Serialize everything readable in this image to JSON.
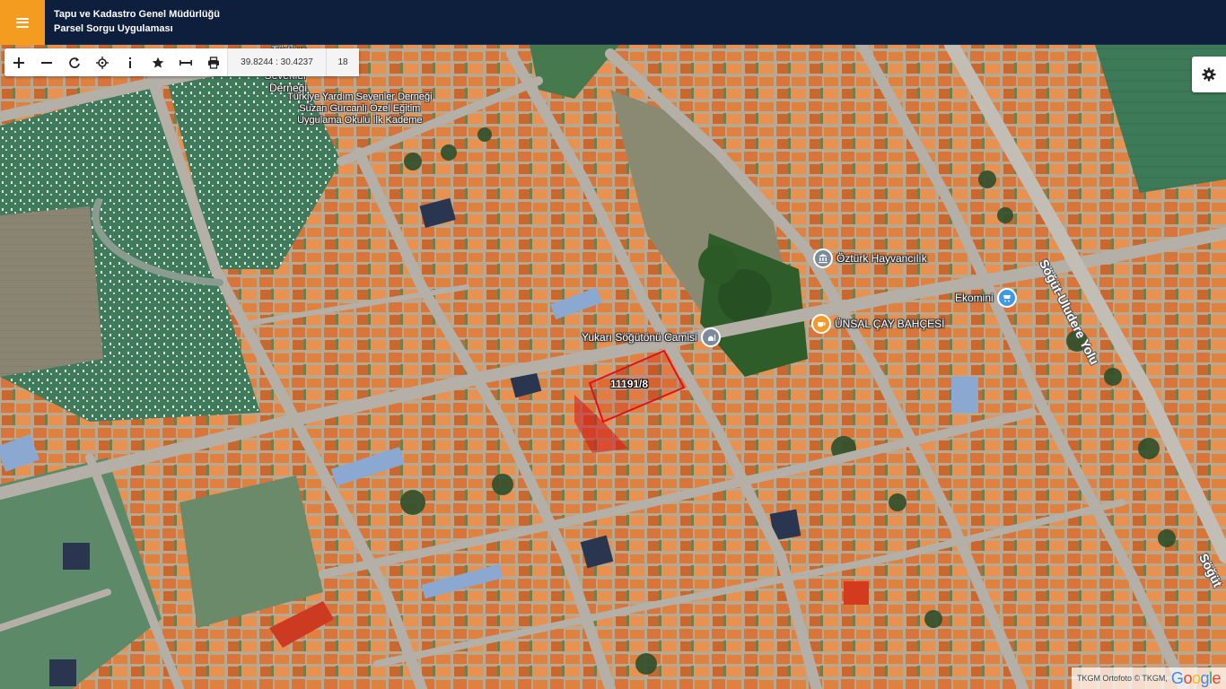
{
  "header": {
    "line1": "Tapu ve Kadastro Genel Müdürlüğü",
    "line2": "Parsel Sorgu Uygulaması"
  },
  "toolbar": {
    "tools": [
      {
        "icon": "plus-icon"
      },
      {
        "icon": "minus-icon"
      },
      {
        "icon": "refresh-icon"
      },
      {
        "icon": "crosshair-icon"
      },
      {
        "icon": "info-icon"
      },
      {
        "icon": "star-icon"
      },
      {
        "icon": "measure-icon"
      },
      {
        "icon": "print-icon"
      }
    ],
    "coordinates": "39.8244 : 30.4237",
    "zoom": "18"
  },
  "map": {
    "parcel_label": "11191/8",
    "pois": {
      "dernegi_title": "Türkiye Yardım\nSevenler Derneği",
      "okul": "Türkiye Yardım Sevenler Derneği\nSuzan Gürcanlı Özel Eğitim\nUygulama Okulu İlk Kademe",
      "hayvancilik": "Öztürk Hayvancılık",
      "ekomini": "Ekomini",
      "cay_bahcesi": "ÜNSAL ÇAY BAHÇESİ",
      "camii": "Yukarı Söğütönü Camisi"
    },
    "road_labels": {
      "main_road": "Söğüt-Uludere Yolu",
      "edge_road": "Söğüt"
    }
  },
  "attribution": {
    "source_text": "TKGM Ortofoto © TKGM,",
    "google": "Google"
  },
  "colors": {
    "header_bg": "#0d1f3c",
    "menu_accent": "#f39c1f",
    "parcel_outline": "#e0101a"
  }
}
